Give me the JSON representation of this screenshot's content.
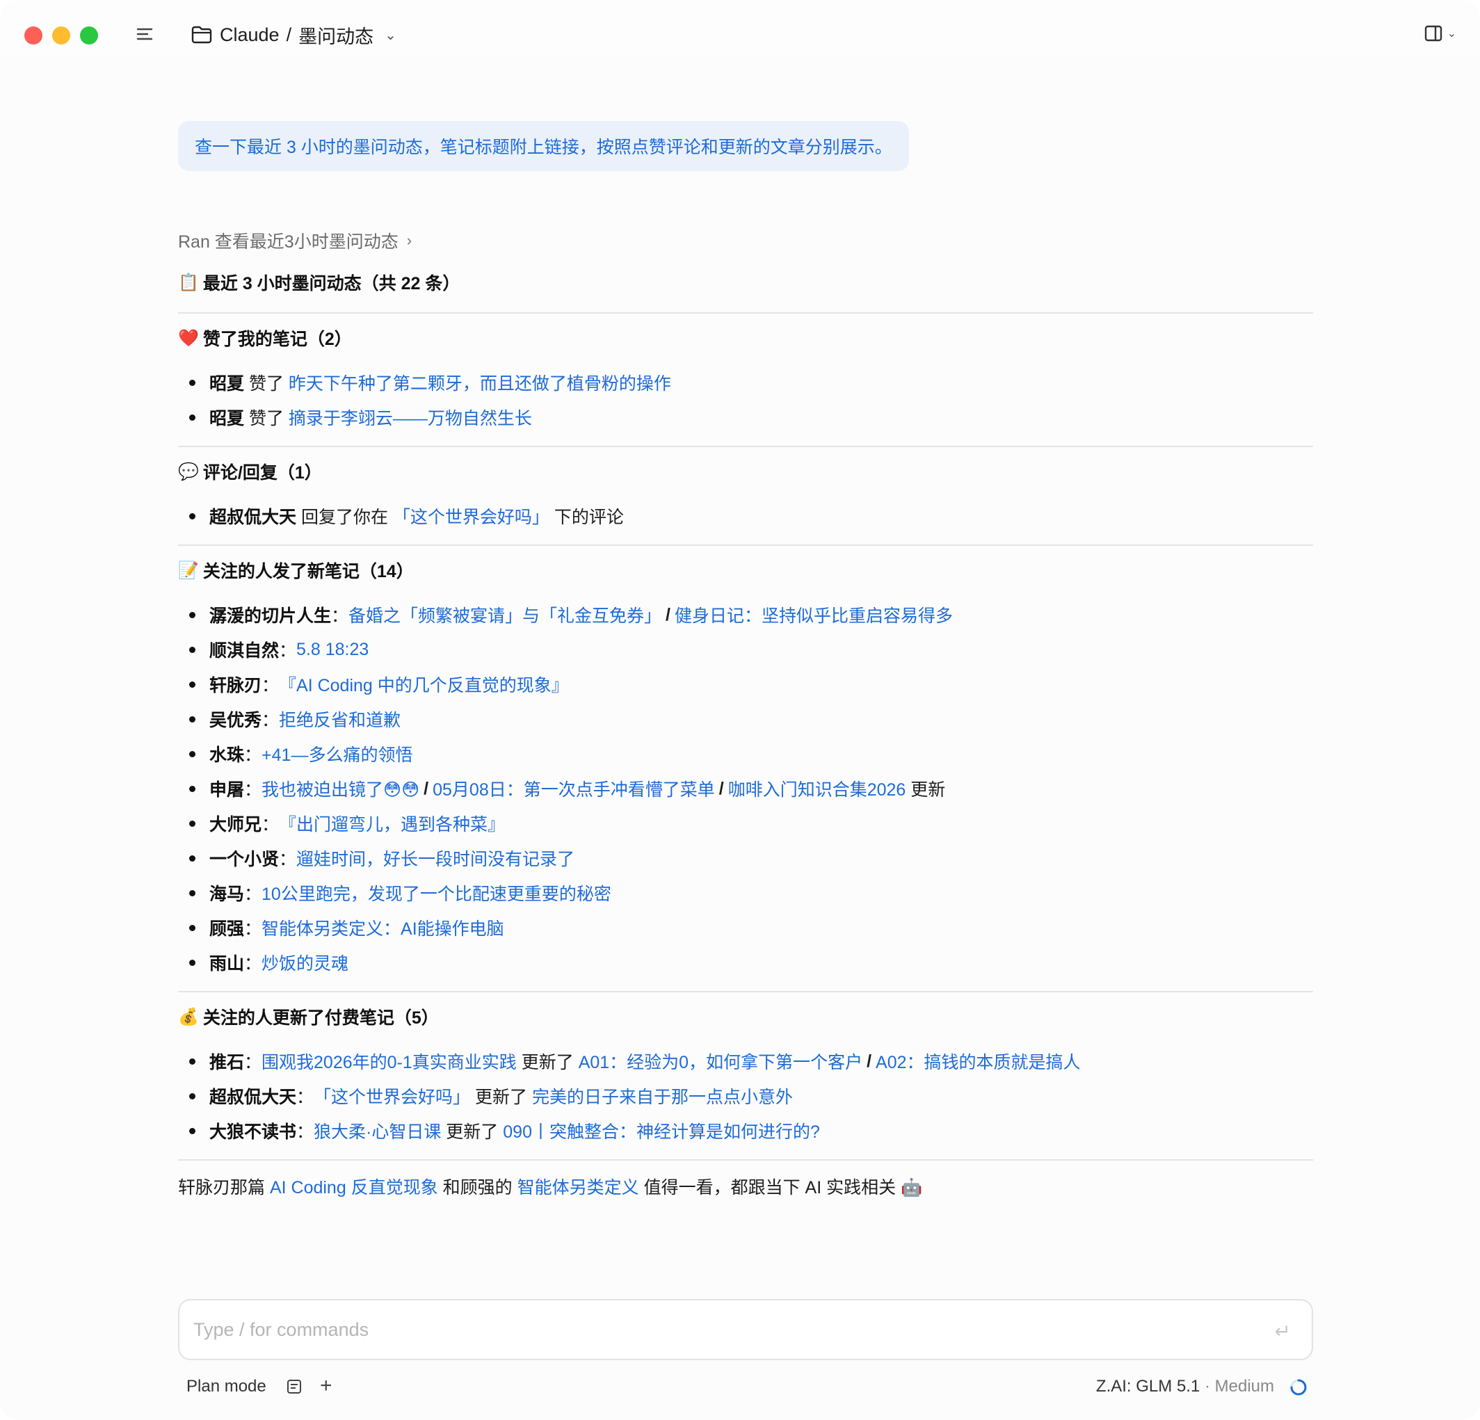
{
  "titlebar": {
    "breadcrumb_root": "Claude",
    "breadcrumb_sep": "/",
    "breadcrumb_current": "墨问动态"
  },
  "user_message": "查一下最近 3 小时的墨问动态，笔记标题附上链接，按照点赞评论和更新的文章分别展示。",
  "tool_call": "Ran 查看最近3小时墨问动态",
  "summary_title": "最近 3 小时墨问动态（共 22 条）",
  "sections": {
    "likes": {
      "heading": "赞了我的笔记（2）",
      "items": [
        {
          "who": "昭夏",
          "verb": " 赞了 ",
          "link": "昨天下午种了第二颗牙，而且还做了植骨粉的操作"
        },
        {
          "who": "昭夏",
          "verb": " 赞了 ",
          "link": "摘录于李翊云——万物自然生长"
        }
      ]
    },
    "comments": {
      "heading": "评论/回复（1）",
      "items": [
        {
          "who": "超叔侃大天",
          "verb": " 回复了你在 ",
          "link": "「这个世界会好吗」",
          "tail": " 下的评论"
        }
      ]
    },
    "new_notes": {
      "heading": "关注的人发了新笔记（14）",
      "items": [
        {
          "who": "潺湲的切片人生",
          "colon": "：",
          "links": [
            "备婚之「频繁被宴请」与「礼金互免券」",
            "健身日记：坚持似乎比重启容易得多"
          ]
        },
        {
          "who": "顺淇自然",
          "colon": "：",
          "links": [
            "5.8 18:23"
          ]
        },
        {
          "who": "轩脉刃",
          "colon": "：",
          "links": [
            "『AI Coding 中的几个反直觉的现象』"
          ]
        },
        {
          "who": "吴优秀",
          "colon": "：",
          "links": [
            "拒绝反省和道歉"
          ]
        },
        {
          "who": "水珠",
          "colon": "：",
          "links": [
            "+41—多么痛的领悟"
          ]
        },
        {
          "who": "申屠",
          "colon": "：",
          "links": [
            "我也被迫出镜了😳😳",
            "05月08日：第一次点手冲看懵了菜单",
            "咖啡入门知识合集2026"
          ],
          "tail": " 更新"
        },
        {
          "who": "大师兄",
          "colon": "：",
          "links": [
            "『出门遛弯儿，遇到各种菜』"
          ]
        },
        {
          "who": "一个小贤",
          "colon": "：",
          "links": [
            "遛娃时间，好长一段时间没有记录了"
          ]
        },
        {
          "who": "海马",
          "colon": "：",
          "links": [
            "10公里跑完，发现了一个比配速更重要的秘密"
          ]
        },
        {
          "who": "顾强",
          "colon": "：",
          "links": [
            "智能体另类定义：AI能操作电脑"
          ]
        },
        {
          "who": "雨山",
          "colon": "：",
          "links": [
            "炒饭的灵魂"
          ]
        }
      ]
    },
    "paid": {
      "heading": "关注的人更新了付费笔记（5）",
      "items": [
        {
          "who": "推石",
          "colon": "：",
          "column": "围观我2026年的0-1真实商业实践",
          "verb": " 更新了 ",
          "links": [
            "A01：经验为0，如何拿下第一个客户",
            "A02：搞钱的本质就是搞人"
          ]
        },
        {
          "who": "超叔侃大天",
          "colon": "：",
          "column": "「这个世界会好吗」",
          "verb": " 更新了 ",
          "links": [
            "完美的日子来自于那一点点小意外"
          ]
        },
        {
          "who": "大狼不读书",
          "colon": "：",
          "column": "狼大柔·心智日课",
          "verb": " 更新了 ",
          "links": [
            "090丨突触整合：神经计算是如何进行的?"
          ]
        }
      ]
    }
  },
  "footer": {
    "pre": "轩脉刃那篇 ",
    "link1": "AI Coding 反直觉现象",
    "mid": " 和顾强的 ",
    "link2": "智能体另类定义",
    "post": " 值得一看，都跟当下 AI 实践相关 🤖"
  },
  "composer": {
    "placeholder": "Type / for commands"
  },
  "bottom_bar": {
    "mode": "Plan mode",
    "model": "Z.AI: GLM 5.1",
    "effort_sep": " · ",
    "effort": "Medium"
  },
  "icons": {
    "emoji_clipboard": "📋",
    "emoji_heart": "❤️",
    "emoji_speech": "💬",
    "emoji_memo": "📝",
    "emoji_money": "💰"
  },
  "colors": {
    "link": "#1e6bd6",
    "user_bubble_bg": "#eaf1fb",
    "traffic_red": "#fe5f57",
    "traffic_yellow": "#febc2e",
    "traffic_green": "#28c840"
  }
}
